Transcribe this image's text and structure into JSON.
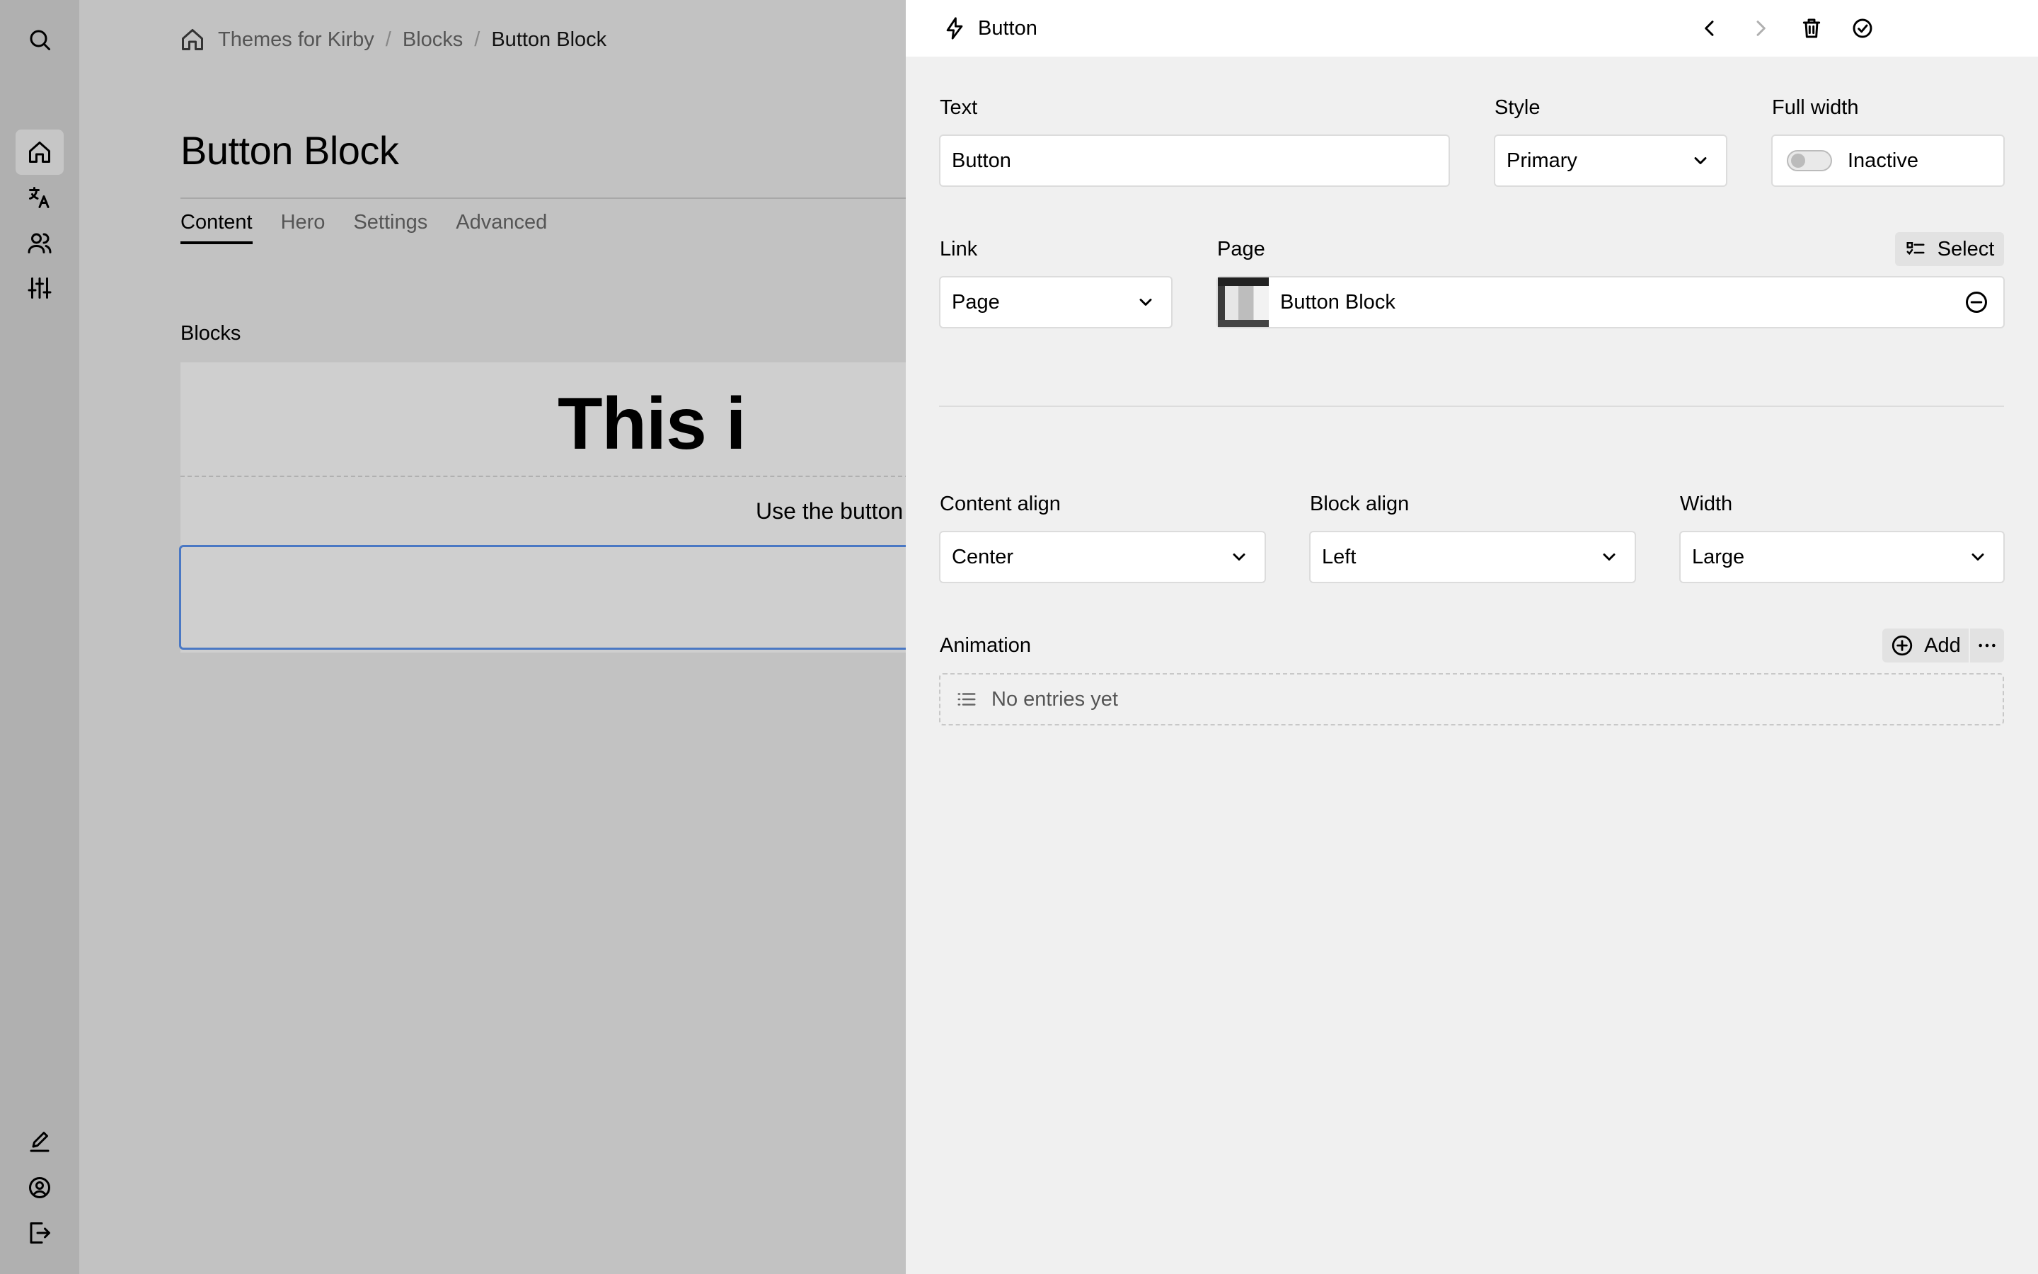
{
  "menu": {
    "top": [
      {
        "name": "search-icon"
      },
      {
        "name": "home-icon",
        "active": true
      },
      {
        "name": "translate-icon"
      },
      {
        "name": "users-icon"
      },
      {
        "name": "sliders-icon"
      }
    ],
    "bottom": [
      {
        "name": "edit-icon"
      },
      {
        "name": "account-icon"
      },
      {
        "name": "logout-icon"
      }
    ]
  },
  "breadcrumb": {
    "items": [
      "Themes for Kirby",
      "Blocks",
      "Button Block"
    ]
  },
  "page": {
    "title": "Button Block",
    "tabs": [
      "Content",
      "Hero",
      "Settings",
      "Advanced"
    ],
    "active_tab": "Content",
    "blocks_label": "Blocks",
    "hero_heading": "This i",
    "hero_subtext": "Use the button"
  },
  "drawer": {
    "title": "Button",
    "title_icon": "bolt-icon",
    "fields": {
      "text": {
        "label": "Text",
        "value": "Button"
      },
      "style": {
        "label": "Style",
        "value": "Primary"
      },
      "full_width": {
        "label": "Full width",
        "value": "Inactive"
      },
      "link": {
        "label": "Link",
        "value": "Page"
      },
      "page": {
        "label": "Page",
        "select_label": "Select",
        "value": "Button Block"
      },
      "content_align": {
        "label": "Content align",
        "value": "Center"
      },
      "block_align": {
        "label": "Block align",
        "value": "Left"
      },
      "width": {
        "label": "Width",
        "value": "Large"
      },
      "animation": {
        "label": "Animation",
        "add_label": "Add",
        "empty_text": "No entries yet"
      }
    }
  },
  "colors": {
    "accent": "#4a78c4",
    "drawer_bg": "#f0f0f0",
    "overlay": "#c2c2c2"
  }
}
